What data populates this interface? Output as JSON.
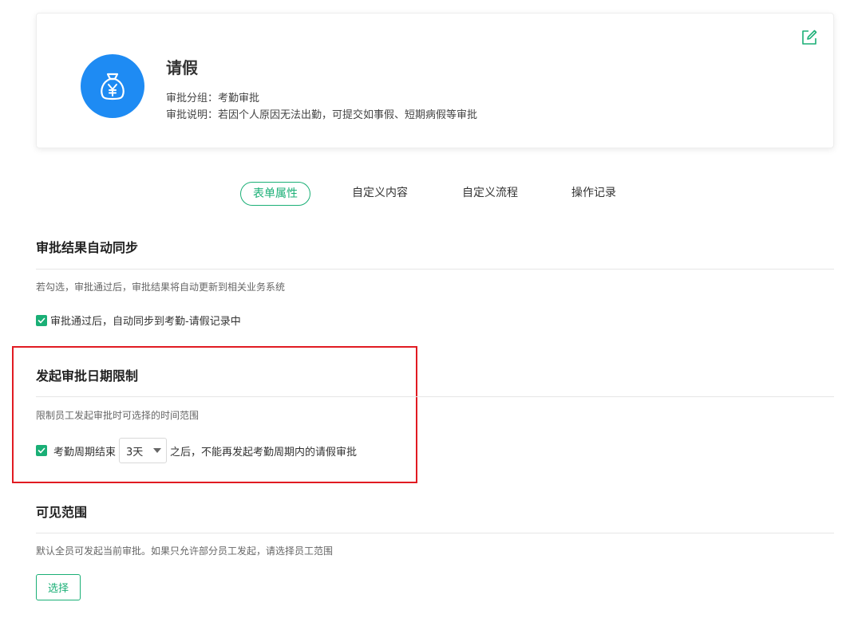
{
  "header_card": {
    "title": "请假",
    "group_label": "审批分组：",
    "group_value": "考勤审批",
    "desc_label": "审批说明：",
    "desc_value": "若因个人原因无法出勤，可提交如事假、短期病假等审批",
    "icon": "money-bag-yen-icon",
    "icon_color": "#1e8bf3"
  },
  "tabs": [
    {
      "label": "表单属性",
      "active": true
    },
    {
      "label": "自定义内容",
      "active": false
    },
    {
      "label": "自定义流程",
      "active": false
    },
    {
      "label": "操作记录",
      "active": false
    }
  ],
  "sections": {
    "sync": {
      "title": "审批结果自动同步",
      "desc": "若勾选，审批通过后，审批结果将自动更新到相关业务系统",
      "checkbox_label": "审批通过后，自动同步到考勤-请假记录中",
      "checked": true
    },
    "date_limit": {
      "title": "发起审批日期限制",
      "desc": "限制员工发起审批时可选择的时间范围",
      "checked": true,
      "prefix": "考勤周期结束",
      "select_value": "3天",
      "suffix": "之后，不能再发起考勤周期内的请假审批"
    },
    "visibility": {
      "title": "可见范围",
      "desc": "默认全员可发起当前审批。如果只允许部分员工发起，请选择员工范围",
      "button_label": "选择"
    }
  },
  "colors": {
    "accent": "#1aaf76",
    "highlight": "#e11b22"
  }
}
